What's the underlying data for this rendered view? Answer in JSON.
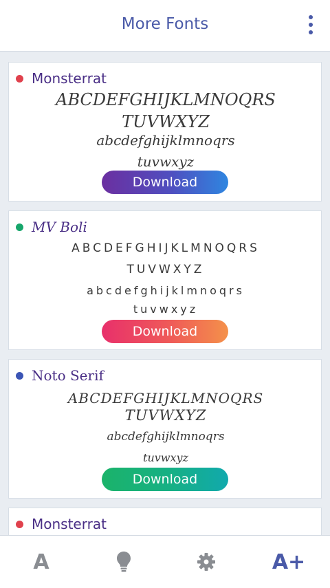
{
  "app": {
    "title": "More Fonts"
  },
  "cards": [
    {
      "font_name": "Monsterrat",
      "dot_color": "#e0414d",
      "lines": [
        "ABCDEFGHIJKLMNOQRS",
        "TUVWXYZ",
        "abcdefghijklmnoqrs",
        "tuvwxyz"
      ],
      "download_label": "Download"
    },
    {
      "font_name": "MV Boli",
      "dot_color": "#17a66b",
      "lines": [
        "ABCDEFGHIJKLMNOQRS",
        "TUVWXYZ",
        "abcdefghijklmnoqrs",
        "tuvwxyz"
      ],
      "download_label": "Download"
    },
    {
      "font_name": "Noto Serif",
      "dot_color": "#3b55b5",
      "lines": [
        "ABCDEFGHIJKLMNOQRS",
        "TUVWXYZ",
        "abcdefghijklmnoqrs",
        "tuvwxyz"
      ],
      "download_label": "Download"
    },
    {
      "font_name": "Monsterrat",
      "dot_color": "#e0414d"
    }
  ],
  "bottom_nav": [
    {
      "label": "A",
      "icon": "font-icon"
    },
    {
      "icon": "lightbulb-icon"
    },
    {
      "icon": "gear-icon"
    },
    {
      "label": "A+",
      "icon": "more-fonts-icon"
    }
  ],
  "colors": {
    "accent": "#4a5aa8",
    "name_text": "#4a2f86"
  }
}
